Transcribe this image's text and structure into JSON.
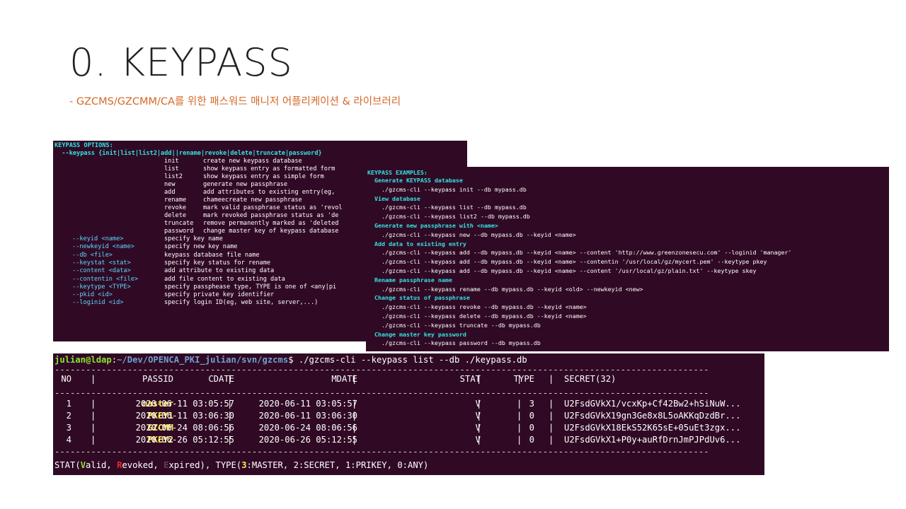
{
  "slide": {
    "title": "0. KEYPASS",
    "subtitle": "- GZCMS/GZCMM/CA를 위한 패스워드 매니저 어플리케이션 & 라이브러리"
  },
  "options": {
    "heading": "KEYPASS OPTIONS:",
    "usage": "  --keypass {init|list|list2|add||rename|revoke|delete|truncate|password}",
    "subcommands": [
      {
        "name": "init",
        "desc": "create new keypass database"
      },
      {
        "name": "list",
        "desc": "show keypass entry as formatted form"
      },
      {
        "name": "list2",
        "desc": "show keypass entry as simple form"
      },
      {
        "name": "new",
        "desc": "generate new passphrase"
      },
      {
        "name": "add",
        "desc": "add attributes to existing entry(eg, "
      },
      {
        "name": "rename",
        "desc": "chameecreate new passphrase"
      },
      {
        "name": "revoke",
        "desc": "mark valid passphrase status as 'revol"
      },
      {
        "name": "delete",
        "desc": "mark revoked passphrase status as 'de"
      },
      {
        "name": "truncate",
        "desc": "remove permanently marked as 'deleted"
      },
      {
        "name": "password",
        "desc": "change master key of keypass database"
      }
    ],
    "flags": [
      {
        "flag": "--keyid <name>",
        "desc": "specify key name"
      },
      {
        "flag": "--newkeyid <name>",
        "desc": "specify new key name"
      },
      {
        "flag": "--db <file>",
        "desc": "keypass database file name"
      },
      {
        "flag": "--keystat <stat>",
        "desc": "specify key status for rename"
      },
      {
        "flag": "--content <data>",
        "desc": "add attribute to existing data"
      },
      {
        "flag": "--contentin <file>",
        "desc": "add file content to existing data"
      },
      {
        "flag": "--keytype <TYPE>",
        "desc": "specify passphease type, TYPE is one of <any|pi"
      },
      {
        "flag": "--pkid <id>",
        "desc": "specify private key identifier"
      },
      {
        "flag": "--loginid <id>",
        "desc": "specify login ID(eg, web site, server,...)"
      }
    ]
  },
  "examples": {
    "heading": "KEYPASS EXAMPLES:",
    "lines": [
      {
        "t": "h",
        "text": "  Generate KEYPASS database"
      },
      {
        "t": "c",
        "text": "    ./gzcms-cli --keypass init --db mypass.db"
      },
      {
        "t": "h",
        "text": "  View database"
      },
      {
        "t": "c",
        "text": "    ./gzcms-cli --keypass list --db mypass.db"
      },
      {
        "t": "c",
        "text": "    ./gzcms-cli --keypass list2 --db mypass.db"
      },
      {
        "t": "h",
        "text": "  Generate new passphrase with <name>"
      },
      {
        "t": "c",
        "text": "    ./gzcms-cli --keypass new --db mypass.db --keyid <name>"
      },
      {
        "t": "h",
        "text": "  Add data to existing entry"
      },
      {
        "t": "c",
        "text": "    ./gzcms-cli --keypass add --db mypass.db --keyid <name> --content 'http://www.greenzonesecu.com' --loginid 'manager'"
      },
      {
        "t": "c",
        "text": "    ./gzcms-cli --keypass add --db mypass.db --keyid <name> --contentin '/usr/local/gz/mycert.pem' --keytype pkey"
      },
      {
        "t": "c",
        "text": "    ./gzcms-cli --keypass add --db mypass.db --keyid <name> --content '/usr/local/gz/plain.txt' --keytype skey"
      },
      {
        "t": "h",
        "text": "  Rename passphrase name"
      },
      {
        "t": "c",
        "text": "    ./gzcms-cli --keypass rename --db mypass.db --keyid <old> --newkeyid <new>"
      },
      {
        "t": "h",
        "text": "  Change status of passphrase"
      },
      {
        "t": "c",
        "text": "    ./gzcms-cli --keypass revoke --db mypass.db --keyid <name>"
      },
      {
        "t": "c",
        "text": "    ./gzcms-cli --keypass delete --db mypass.db --keyid <name>"
      },
      {
        "t": "c",
        "text": "    ./gzcms-cli --keypass truncate --db mypass.db"
      },
      {
        "t": "h",
        "text": "  Change master key password"
      },
      {
        "t": "c",
        "text": "    ./gzcms-cli --keypass password --db mypass.db"
      }
    ]
  },
  "listing": {
    "prompt_user": "julian@ldap",
    "prompt_sep": ":",
    "prompt_path": "~/Dev/OPENCA_PKI_julian/svn/gzcms",
    "command": "$ ./gzcms-cli --keypass list --db ./keypass.db",
    "separator": "------------------------------------------------------------------------------------------------------------------------------",
    "headers": [
      "NO",
      "PASSID",
      "CDATE",
      "MDATE",
      "STAT",
      "TYPE",
      "SECRET(32)"
    ],
    "rows": [
      {
        "no": "1",
        "passid": "master",
        "cdate": "2020-06-11 03:05:57",
        "mdate": "2020-06-11 03:05:57",
        "stat": "V",
        "type": "3",
        "secret": "U2FsdGVkX1/vcxKp+Cf42Bw2+hSiNuW..."
      },
      {
        "no": "2",
        "passid": "PKEY1",
        "cdate": "2020-06-11 03:06:30",
        "mdate": "2020-06-11 03:06:30",
        "stat": "V",
        "type": "0",
        "secret": "U2FsdGVkX19gn3Ge8x8L5oAKKqDzdBr..."
      },
      {
        "no": "3",
        "passid": "GZCMM",
        "cdate": "2020-06-24 08:06:56",
        "mdate": "2020-06-24 08:06:56",
        "stat": "V",
        "type": "0",
        "secret": "U2FsdGVkX18EkS52K65sE+05uEt3zgx..."
      },
      {
        "no": "4",
        "passid": "PKEY2",
        "cdate": "2020-06-26 05:12:55",
        "mdate": "2020-06-26 05:12:55",
        "stat": "V",
        "type": "0",
        "secret": "U2FsdGVkX1+P0y+auRfDrnJmPJPdUv6..."
      }
    ],
    "legend": {
      "p1": "STAT(",
      "v": "V",
      "p2": "alid, ",
      "r": "R",
      "p3": "evoked, ",
      "e": "E",
      "p4": "xpired), TYPE(",
      "t3": "3",
      "p5": ":MASTER, 2:SECRET, 1:PRIKEY, 0:ANY)"
    }
  },
  "colors": {
    "terminal_bg": "#300a24",
    "title_text": "#222222",
    "subtitle_text": "#d4692a",
    "heading_cyan": "#34e2e2",
    "passid_yellow": "#fce94f",
    "prompt_green": "#8ae234",
    "prompt_blue": "#729fcf",
    "revoked_red": "#ef2929"
  }
}
